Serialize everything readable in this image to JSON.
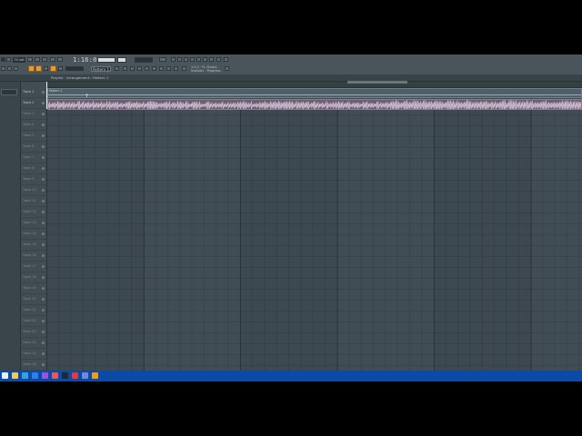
{
  "app": {
    "tempo_label": "70 set",
    "song_time": "1:16:07",
    "pattern_selector": "Pattern 1",
    "hint_text": "1.5.2 · FL Studio Installer · Progress"
  },
  "breadcrumb": "Playlist · Arrangement › Pattern 1",
  "tracks": [
    {
      "label": "Track 1",
      "active": true
    },
    {
      "label": "Track 2",
      "active": true
    },
    {
      "label": "Track 3"
    },
    {
      "label": "Track 4"
    },
    {
      "label": "Track 5"
    },
    {
      "label": "Track 6"
    },
    {
      "label": "Track 7"
    },
    {
      "label": "Track 8"
    },
    {
      "label": "Track 9"
    },
    {
      "label": "Track 10"
    },
    {
      "label": "Track 11"
    },
    {
      "label": "Track 12"
    },
    {
      "label": "Track 13"
    },
    {
      "label": "Track 14"
    },
    {
      "label": "Track 15"
    },
    {
      "label": "Track 16"
    },
    {
      "label": "Track 17"
    },
    {
      "label": "Track 18"
    },
    {
      "label": "Track 19"
    },
    {
      "label": "Track 20"
    },
    {
      "label": "Track 21"
    },
    {
      "label": "Track 22"
    },
    {
      "label": "Track 23"
    },
    {
      "label": "Track 24"
    },
    {
      "label": "Track 25"
    },
    {
      "label": "Track 26"
    }
  ],
  "clips": {
    "pattern_clip_label": "Pattern 1",
    "audio_clip_color": "#6b5f70"
  },
  "colors": {
    "accent": "#e59a3a",
    "taskbar": "#0d4aa6"
  },
  "taskbar_icons": [
    "start-icon",
    "folder-icon",
    "chrome-icon",
    "store-icon",
    "app-icon",
    "media-icon",
    "terminal-icon",
    "youtube-icon",
    "discord-icon",
    "fl-studio-icon"
  ]
}
